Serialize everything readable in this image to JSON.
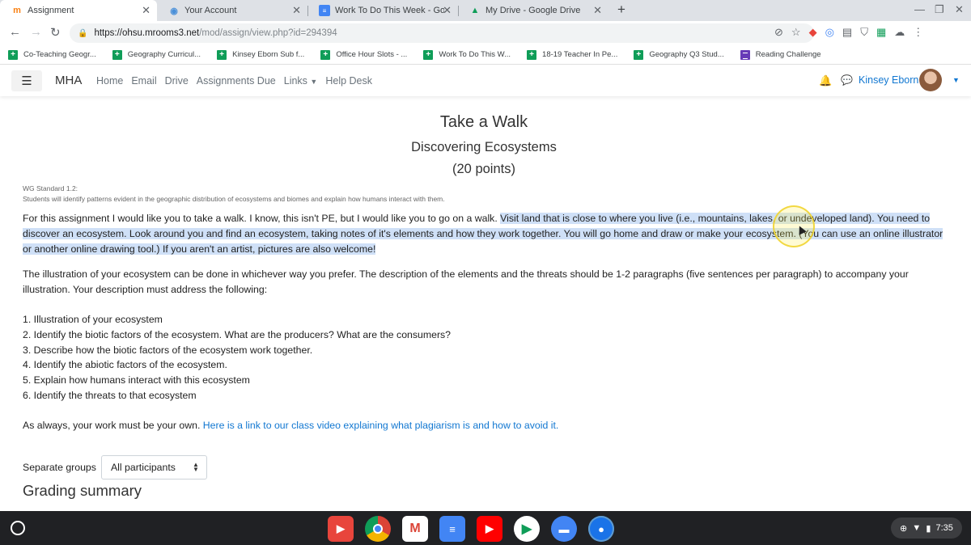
{
  "browser": {
    "tabs": [
      {
        "title": "Assignment",
        "icon": "moodle-icon",
        "active": true
      },
      {
        "title": "Your Account",
        "icon": "account-icon",
        "active": false
      },
      {
        "title": "Work To Do This Week - Google D",
        "icon": "google-docs-icon",
        "active": false
      },
      {
        "title": "My Drive - Google Drive",
        "icon": "google-drive-icon",
        "active": false
      }
    ],
    "url_host": "https://ohsu.mrooms3.net",
    "url_path": "/mod/assign/view.php?id=294394",
    "bookmarks": [
      {
        "label": "Co-Teaching Geogr...",
        "icon": "sheets"
      },
      {
        "label": "Geography Curricul...",
        "icon": "sheets"
      },
      {
        "label": "Kinsey Eborn Sub f...",
        "icon": "sheets"
      },
      {
        "label": "Office Hour Slots - ...",
        "icon": "sheets"
      },
      {
        "label": "Work To Do This W...",
        "icon": "sheets"
      },
      {
        "label": "18-19 Teacher In Pe...",
        "icon": "sheets"
      },
      {
        "label": "Geography Q3 Stud...",
        "icon": "sheets"
      },
      {
        "label": "Reading Challenge",
        "icon": "forms"
      }
    ]
  },
  "navbar": {
    "brand": "MHA",
    "links": [
      "Home",
      "Email",
      "Drive",
      "Assignments Due",
      "Links",
      "Help Desk"
    ],
    "user_name": "Kinsey Eborn"
  },
  "assignment": {
    "title": "Take a Walk",
    "subtitle": "Discovering Ecosystems",
    "points": "(20 points)",
    "standard_code": "WG Standard 1.2:",
    "standard_text": "Students will identify patterns evident in the geographic distribution of ecosystems and biomes and explain how humans interact with them.",
    "p1_plain": "For this assignment I would like you to take a walk. I know, this isn't PE, but I would like you to go on a walk. ",
    "p1_highlight": "Visit land that is close to where you live (i.e., mountains, lakes, or undeveloped land). You need to discover an ecosystem. Look around you and find an ecosystem, taking notes of it's elements and how they work together. You will go home and draw or make your ecosystem. (You can use an online illustrator or another online drawing tool.) If you aren't an artist, pictures are also welcome!",
    "p2": "The illustration of your ecosystem can be done in whichever way you prefer. The description of the elements and the threats should be 1-2 paragraphs (five sentences per paragraph) to accompany your illustration. Your description must address the following:",
    "requirements": [
      "1. Illustration of your ecosystem",
      "2. Identify the biotic factors of the ecosystem. What are the producers? What are the consumers?",
      "3. Describe how the biotic factors of the ecosystem work together.",
      "4. Identify the abiotic factors of the ecosystem.",
      "5. Explain how humans interact with this ecosystem",
      "6. Identify the threats to that ecosystem"
    ],
    "p3_plain": "As always, your work must be your own. ",
    "p3_link": "Here is a link to our class video explaining what plagiarism is and how to avoid it."
  },
  "groups": {
    "label": "Separate groups",
    "selected": "All participants"
  },
  "grading_heading": "Grading summary",
  "system_tray": {
    "time": "7:35"
  },
  "colors": {
    "link": "#1177d1",
    "highlight": "#cfe0f7",
    "shelf": "#202124"
  }
}
